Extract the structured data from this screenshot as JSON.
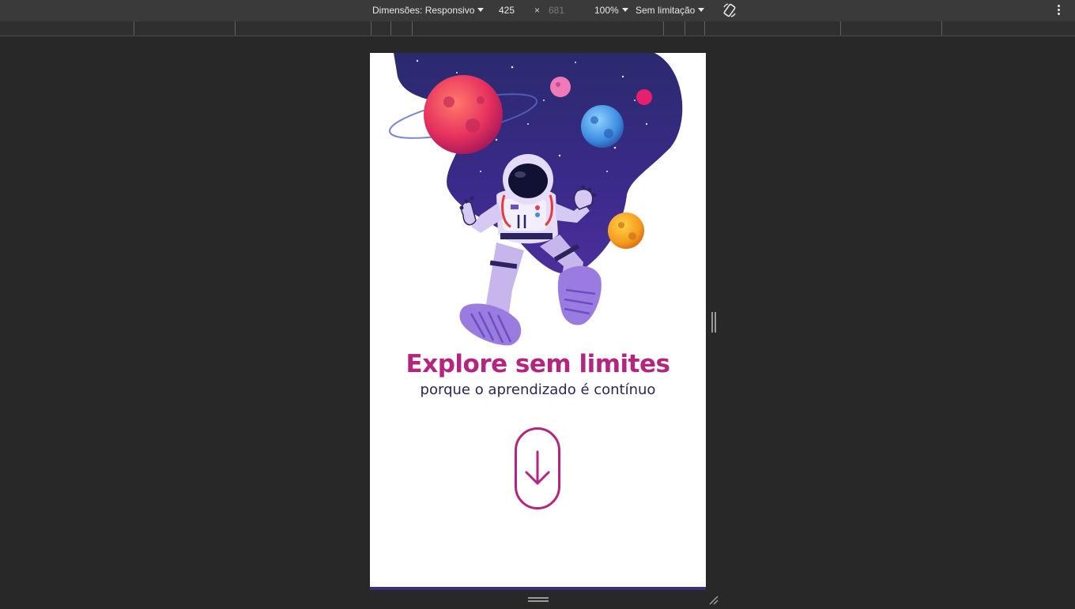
{
  "devtools": {
    "dimensions_label": "Dimensões: Responsivo",
    "width_value": "425",
    "times": "×",
    "height_value": "681",
    "zoom_label": "100%",
    "throttle_label": "Sem limitação",
    "rotate_icon": "rotate-icon",
    "more_icon": "more-vertical-icon"
  },
  "page": {
    "title": "Explore sem limites",
    "subtitle": "porque o aprendizado é contínuo",
    "scroll_icon": "arrow-down-icon",
    "accent_color": "#b3257f",
    "text_color": "#2b2754",
    "illustration": "astronaut-space-illustration"
  }
}
